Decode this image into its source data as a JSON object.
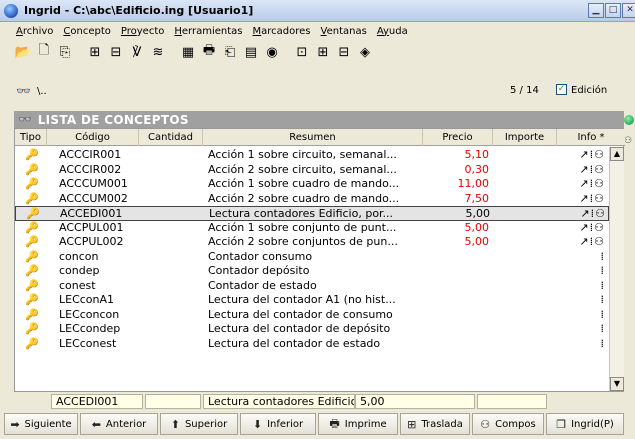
{
  "window": {
    "title": "Ingrid - C:\\abc\\Edificio.ing  [Usuario1]",
    "buttons": [
      "▁",
      "□",
      "✕"
    ]
  },
  "menu": [
    {
      "u": "A",
      "rest": "rchivo"
    },
    {
      "u": "C",
      "rest": "oncepto"
    },
    {
      "u": "Pro",
      "rest": "yecto"
    },
    {
      "u": "H",
      "rest": "erramientas"
    },
    {
      "u": "M",
      "rest": "arcadores"
    },
    {
      "u": "V",
      "rest": "entanas"
    },
    {
      "u": "Ay",
      "rest": "uda"
    }
  ],
  "toolbar_icons": [
    "open-folder-icon",
    "new-document-icon",
    "copy-icon",
    "|",
    "tree-icon",
    "tree-alt-icon",
    "chart-icon",
    "sort-icon",
    "|",
    "module-icon",
    "print-icon",
    "page-icon",
    "sheet-icon",
    "globe-icon",
    "|",
    "window-icon",
    "table-icon",
    "network-icon",
    "tag-icon"
  ],
  "toolbar_glyphs": [
    "📂",
    "🗋",
    "⎘",
    "",
    "⊞",
    "⊟",
    "℣",
    "≋",
    "",
    "▦",
    "🖶",
    "⎗",
    "▤",
    "◉",
    "",
    "⊡",
    "⊞",
    "⊟",
    "◈"
  ],
  "path": {
    "icon": "binoculars-icon",
    "text": "\\.."
  },
  "counter": "5 / 14",
  "edit": {
    "checked": true,
    "label": "Edición"
  },
  "list_title": "LISTA DE CONCEPTOS",
  "columns": [
    "Tipo",
    "Código",
    "Cantidad",
    "Resumen",
    "Precio",
    "Importe",
    "Info *"
  ],
  "rows": [
    {
      "code": "ACCCIR001",
      "resumen": "Acción 1 sobre circuito, semanal...",
      "precio": "5,10",
      "info": "↗⁞⚇"
    },
    {
      "code": "ACCCIR002",
      "resumen": "Acción 2 sobre circuito, semanal...",
      "precio": "0,30",
      "info": "↗⁞⚇"
    },
    {
      "code": "ACCCUM001",
      "resumen": "Acción 1 sobre cuadro de mando...",
      "precio": "11,00",
      "info": "↗⁞⚇"
    },
    {
      "code": "ACCCUM002",
      "resumen": "Acción 2 sobre cuadro de mando...",
      "precio": "7,50",
      "info": "↗⁞⚇"
    },
    {
      "code": "ACCEDI001",
      "resumen": "Lectura contadores Edificio, por...",
      "precio": "5,00",
      "info": "↗⁞⚇",
      "selected": true
    },
    {
      "code": "ACCPUL001",
      "resumen": "Acción 1 sobre conjunto de punt...",
      "precio": "5,00",
      "info": "↗⁞⚇"
    },
    {
      "code": "ACCPUL002",
      "resumen": "Acción 2 sobre conjuntos de pun...",
      "precio": "5,00",
      "info": "↗⁞⚇"
    },
    {
      "code": "concon",
      "resumen": "Contador consumo",
      "precio": "",
      "info": "⁞"
    },
    {
      "code": "condep",
      "resumen": "Contador depósito",
      "precio": "",
      "info": "⁞"
    },
    {
      "code": "conest",
      "resumen": "Contador de estado",
      "precio": "",
      "info": "⁞"
    },
    {
      "code": "LECconA1",
      "resumen": "Lectura del contador A1 (no hist...",
      "precio": "",
      "info": "⁞"
    },
    {
      "code": "LECconcon",
      "resumen": "Lectura del contador de consumo",
      "precio": "",
      "info": "⁞"
    },
    {
      "code": "LECcondep",
      "resumen": "Lectura del contador de depósito",
      "precio": "",
      "info": "⁞"
    },
    {
      "code": "LECconest",
      "resumen": "Lectura del contador de estado",
      "precio": "",
      "info": "⁞"
    }
  ],
  "footer": {
    "code": "ACCEDI001",
    "cantidad": "",
    "resumen": "Lectura contadores Edificio, por Pla",
    "precio": "5,00",
    "importe": ""
  },
  "buttons": [
    {
      "name": "siguiente-button",
      "icon": "arrow-right-icon",
      "glyph": "➡",
      "label": "Siguiente"
    },
    {
      "name": "anterior-button",
      "icon": "arrow-left-icon",
      "glyph": "⬅",
      "label": "Anterior"
    },
    {
      "name": "superior-button",
      "icon": "arrow-up-icon",
      "glyph": "⬆",
      "label": "Superior"
    },
    {
      "name": "inferior-button",
      "icon": "arrow-down-icon",
      "glyph": "⬇",
      "label": "Inferior"
    },
    {
      "name": "imprime-button",
      "icon": "printer-icon",
      "glyph": "🖶",
      "label": "Imprime"
    },
    {
      "name": "traslada-button",
      "icon": "move-icon",
      "glyph": "⊞",
      "label": "Traslada"
    },
    {
      "name": "compos-button",
      "icon": "composition-icon",
      "glyph": "⚇",
      "label": "Compos"
    },
    {
      "name": "ingrid-p-button",
      "icon": "window-icon",
      "glyph": "❐",
      "label": "Ingrid(P)"
    }
  ],
  "row_icon_glyph": "🔑",
  "colors": {
    "price_red": "#e00000",
    "header_gray": "#a0a0a0",
    "selection": "#e4e4e4"
  }
}
